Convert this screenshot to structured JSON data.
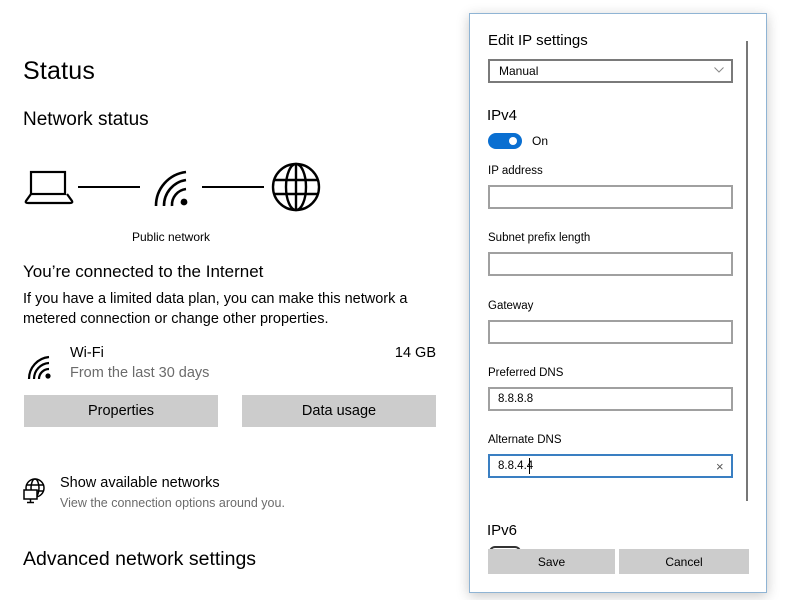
{
  "page": {
    "title": "Status",
    "network_status_heading": "Network status",
    "diagram": {
      "icons": [
        "laptop-icon",
        "wifi-icon",
        "globe-icon"
      ],
      "network_label": "Public network"
    },
    "connection_heading": "You’re connected to the Internet",
    "connection_description": "If you have a limited data plan, you can make this network a metered connection or change other properties.",
    "adapter": {
      "icon": "wifi-icon",
      "name": "Wi-Fi",
      "subtitle": "From the last 30 days",
      "usage": "14 GB"
    },
    "buttons": {
      "properties": "Properties",
      "data_usage": "Data usage"
    },
    "show_networks": {
      "icon": "globe-network-icon",
      "title": "Show available networks",
      "subtitle": "View the connection options around you."
    },
    "advanced_heading": "Advanced network settings"
  },
  "dialog": {
    "title": "Edit IP settings",
    "mode_select": {
      "value": "Manual"
    },
    "ipv4": {
      "heading": "IPv4",
      "toggle_state": "On",
      "accent_color": "#0a6fd1",
      "fields": [
        {
          "label": "IP address",
          "value": ""
        },
        {
          "label": "Subnet prefix length",
          "value": ""
        },
        {
          "label": "Gateway",
          "value": ""
        },
        {
          "label": "Preferred DNS",
          "value": "8.8.8.8"
        },
        {
          "label": "Alternate DNS",
          "value": "8.8.4.4"
        }
      ]
    },
    "ipv6": {
      "heading": "IPv6"
    },
    "buttons": {
      "save": "Save",
      "cancel": "Cancel"
    },
    "clear_glyph": "×"
  }
}
